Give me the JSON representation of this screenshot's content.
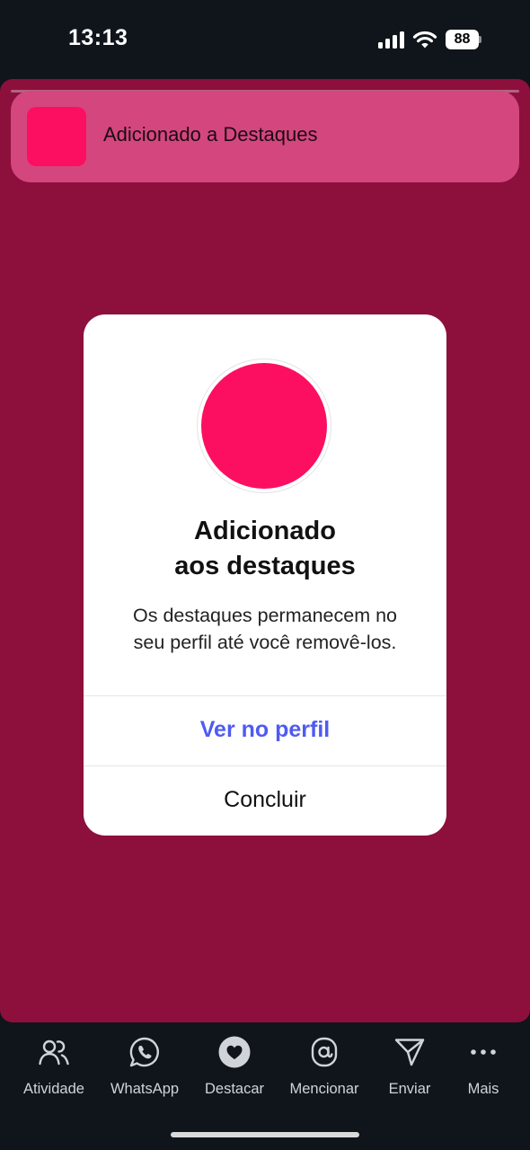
{
  "status_bar": {
    "time": "13:13",
    "battery": "88"
  },
  "toast": {
    "text": "Adicionado a Destaques"
  },
  "dialog": {
    "title_line1": "Adicionado",
    "title_line2": "aos destaques",
    "message_line1": "Os destaques permanecem no",
    "message_line2": "seu perfil até você removê-los.",
    "primary_button": "Ver no perfil",
    "secondary_button": "Concluir"
  },
  "toolbar": {
    "items": [
      {
        "label": "Atividade",
        "icon": "people-icon"
      },
      {
        "label": "WhatsApp",
        "icon": "whatsapp-icon"
      },
      {
        "label": "Destacar",
        "icon": "heart-icon"
      },
      {
        "label": "Mencionar",
        "icon": "at-icon"
      },
      {
        "label": "Enviar",
        "icon": "send-icon"
      },
      {
        "label": "Mais",
        "icon": "more-icon"
      }
    ]
  },
  "colors": {
    "story_background": "#8d0f3c",
    "highlight_pink": "#fc0f60",
    "toast_background": "#d3477e",
    "primary_action": "#4f5bf0"
  }
}
